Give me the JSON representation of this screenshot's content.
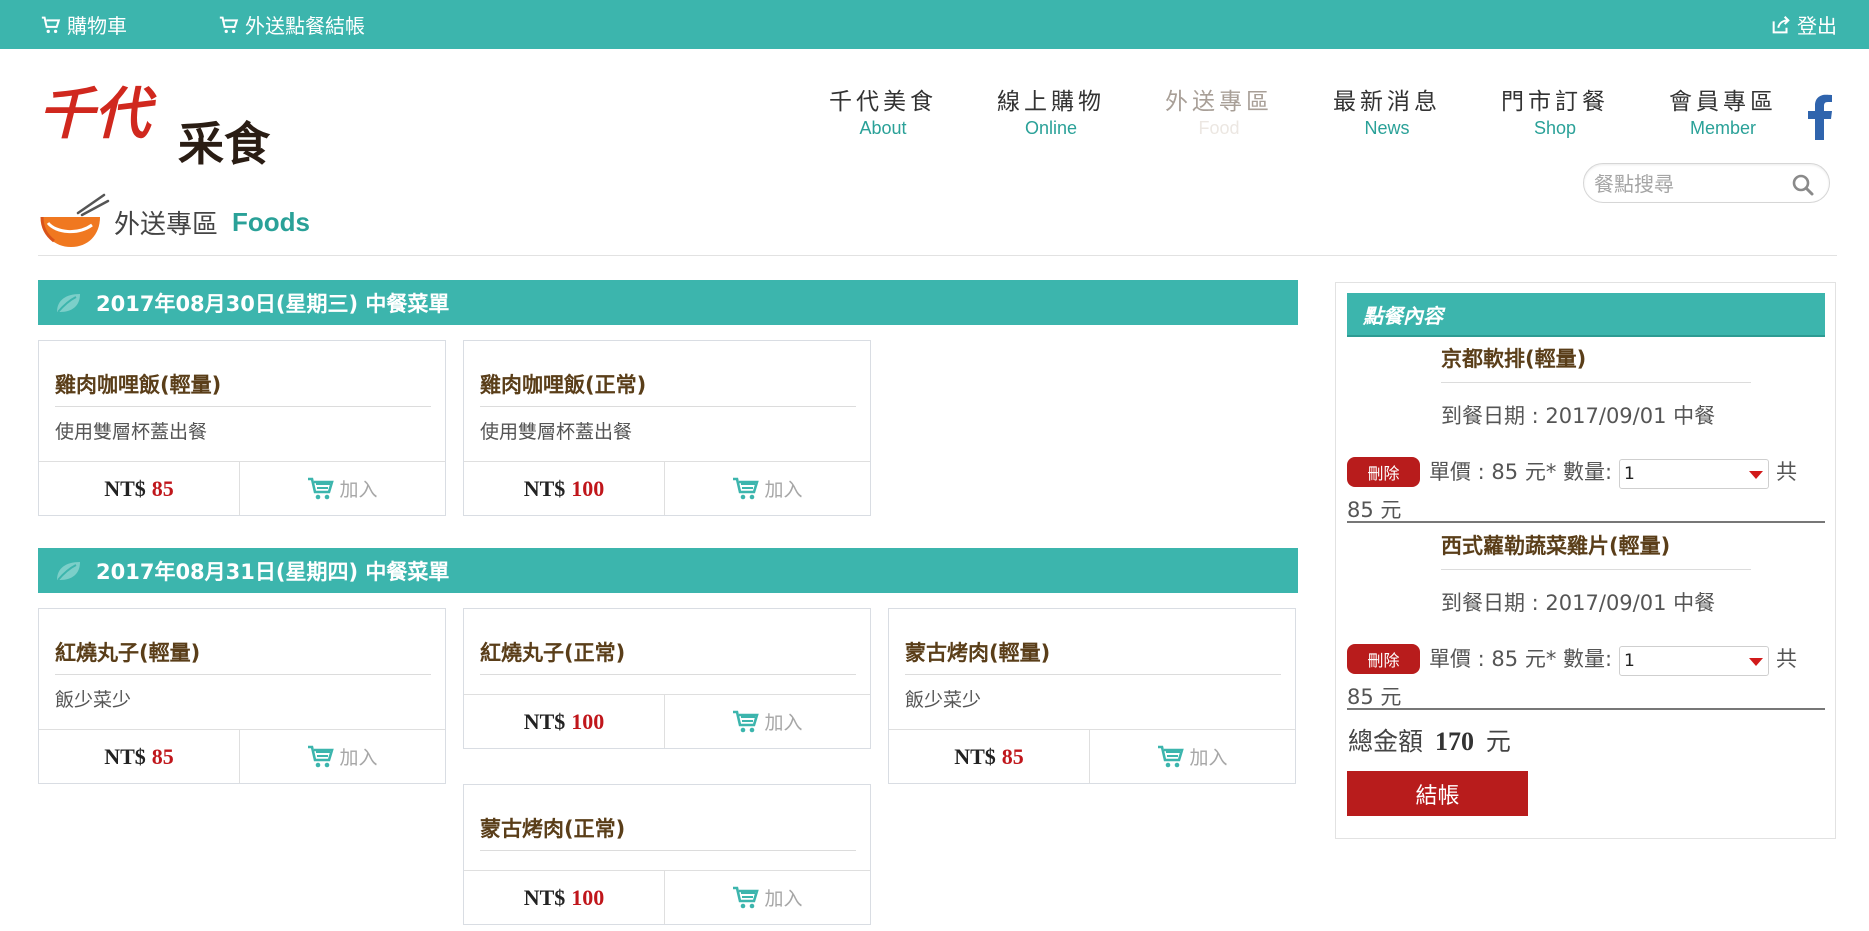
{
  "topbar": {
    "cart_label": "購物車",
    "delivery_checkout_label": "外送點餐結帳",
    "logout_label": "登出"
  },
  "logo": {
    "text_top": "千代",
    "text_bottom": "采食"
  },
  "nav": [
    {
      "zh": "千代美食",
      "en": "About"
    },
    {
      "zh": "線上購物",
      "en": "Online"
    },
    {
      "zh": "外送專區",
      "en": "Food",
      "active": true
    },
    {
      "zh": "最新消息",
      "en": "News"
    },
    {
      "zh": "門市訂餐",
      "en": "Shop"
    },
    {
      "zh": "會員專區",
      "en": "Member"
    }
  ],
  "search": {
    "placeholder": "餐點搜尋"
  },
  "page_title": {
    "zh": "外送專區",
    "en": "Foods"
  },
  "days": [
    {
      "title": "2017年08月30日(星期三) 中餐菜單",
      "items": [
        {
          "name": "雞肉咖哩飯(輕量)",
          "desc": "使用雙層杯蓋出餐",
          "currency": "NT$",
          "price": "85",
          "add_label": "加入"
        },
        {
          "name": "雞肉咖哩飯(正常)",
          "desc": "使用雙層杯蓋出餐",
          "currency": "NT$",
          "price": "100",
          "add_label": "加入"
        }
      ]
    },
    {
      "title": "2017年08月31日(星期四) 中餐菜單",
      "items": [
        {
          "name": "紅燒丸子(輕量)",
          "desc": "飯少菜少",
          "currency": "NT$",
          "price": "85",
          "add_label": "加入"
        },
        {
          "name": "紅燒丸子(正常)",
          "desc": "",
          "currency": "NT$",
          "price": "100",
          "add_label": "加入"
        },
        {
          "name": "蒙古烤肉(輕量)",
          "desc": "飯少菜少",
          "currency": "NT$",
          "price": "85",
          "add_label": "加入"
        },
        {
          "name": "蒙古烤肉(正常)",
          "desc": "",
          "currency": "NT$",
          "price": "100",
          "add_label": "加入"
        }
      ]
    }
  ],
  "cart": {
    "header": "點餐內容",
    "items": [
      {
        "name": "京都軟排(輕量)",
        "date": "到餐日期 : 2017/09/01 中餐",
        "delete_label": "刪除",
        "price_line": "單價 : 85 元* 數量:",
        "qty": "1",
        "gong": "共",
        "subtotal": "85 元"
      },
      {
        "name": "西式蘿勒蔬菜雞片(輕量)",
        "date": "到餐日期 : 2017/09/01 中餐",
        "delete_label": "刪除",
        "price_line": "單價 : 85 元* 數量:",
        "qty": "1",
        "gong": "共",
        "subtotal": "85 元"
      }
    ],
    "total_label": "總金額",
    "total_amount": "170",
    "total_unit": "元",
    "checkout_label": "結帳"
  },
  "colors": {
    "brand_teal": "#3cb5ad",
    "accent_red": "#b81c1c",
    "price_red": "#c0161b"
  },
  "icons": {
    "cart": "cart-icon",
    "logout": "share-icon",
    "facebook": "facebook-icon",
    "search": "search-icon",
    "leaf": "leaf-icon",
    "bowl": "bowl-icon"
  }
}
